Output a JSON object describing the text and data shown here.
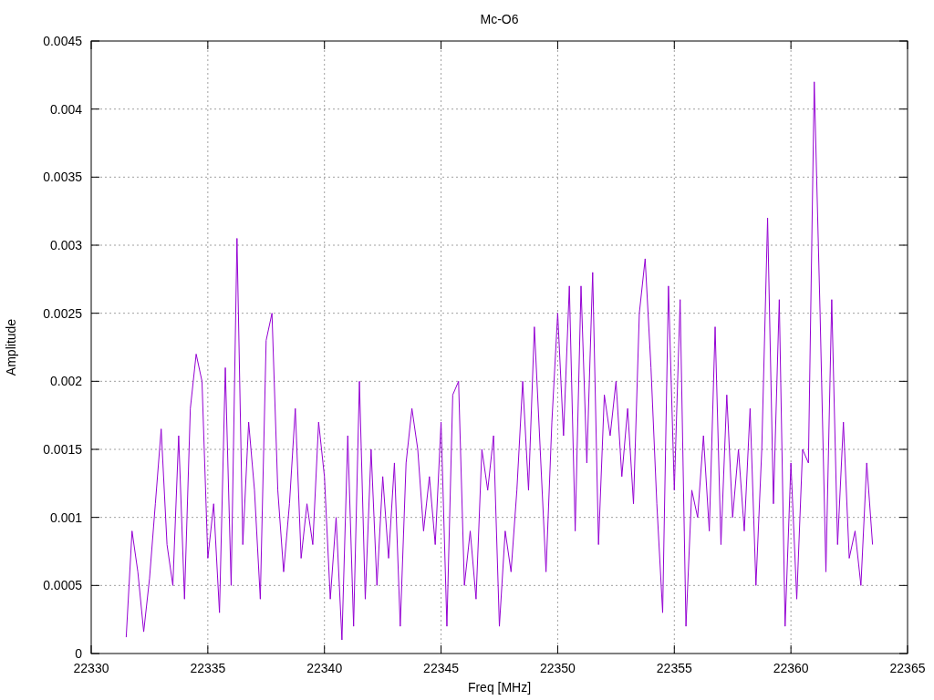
{
  "chart_data": {
    "type": "line",
    "grid": true,
    "title": "Mc-O6",
    "xlabel": "Freq [MHz]",
    "ylabel": "Amplitude",
    "x": [
      22331.5,
      22331.75,
      22332,
      22332.25,
      22332.5,
      22332.75,
      22333,
      22333.25,
      22333.5,
      22333.75,
      22334,
      22334.25,
      22334.5,
      22334.75,
      22335,
      22335.25,
      22335.5,
      22335.75,
      22336,
      22336.25,
      22336.5,
      22336.75,
      22337,
      22337.25,
      22337.5,
      22337.75,
      22338,
      22338.25,
      22338.5,
      22338.75,
      22339,
      22339.25,
      22339.5,
      22339.75,
      22340,
      22340.25,
      22340.5,
      22340.75,
      22341,
      22341.25,
      22341.5,
      22341.75,
      22342,
      22342.25,
      22342.5,
      22342.75,
      22343,
      22343.25,
      22343.5,
      22343.75,
      22344,
      22344.25,
      22344.5,
      22344.75,
      22345,
      22345.25,
      22345.5,
      22345.75,
      22346,
      22346.25,
      22346.5,
      22346.75,
      22347,
      22347.25,
      22347.5,
      22347.75,
      22348,
      22348.25,
      22348.5,
      22348.75,
      22349,
      22349.25,
      22349.5,
      22349.75,
      22350,
      22350.25,
      22350.5,
      22350.75,
      22351,
      22351.25,
      22351.5,
      22351.75,
      22352,
      22352.25,
      22352.5,
      22352.75,
      22353,
      22353.25,
      22353.5,
      22353.75,
      22354,
      22354.25,
      22354.5,
      22354.75,
      22355,
      22355.25,
      22355.5,
      22355.75,
      22356,
      22356.25,
      22356.5,
      22356.75,
      22357,
      22357.25,
      22357.5,
      22357.75,
      22358,
      22358.25,
      22358.5,
      22358.75,
      22359,
      22359.25,
      22359.5,
      22359.75,
      22360,
      22360.25,
      22360.5,
      22360.75,
      22361,
      22361.25,
      22361.5,
      22361.75,
      22362,
      22362.25,
      22362.5,
      22362.75,
      22363,
      22363.25,
      22363.5
    ],
    "series": [
      {
        "color": "#9400d3",
        "values": [
          0.00012,
          0.0009,
          0.0006,
          0.00016,
          0.00055,
          0.0011,
          0.00165,
          0.0008,
          0.0005,
          0.0016,
          0.0004,
          0.0018,
          0.0022,
          0.002,
          0.0007,
          0.0011,
          0.0003,
          0.0021,
          0.0005,
          0.00305,
          0.0008,
          0.0017,
          0.0012,
          0.0004,
          0.0023,
          0.0025,
          0.0012,
          0.0006,
          0.0011,
          0.0018,
          0.0007,
          0.0011,
          0.0008,
          0.0017,
          0.0013,
          0.0004,
          0.001,
          0.0001,
          0.0016,
          0.0002,
          0.002,
          0.0004,
          0.0015,
          0.0005,
          0.0013,
          0.0007,
          0.0014,
          0.0002,
          0.0014,
          0.0018,
          0.0015,
          0.0009,
          0.0013,
          0.0008,
          0.0017,
          0.0002,
          0.0019,
          0.002,
          0.0005,
          0.0009,
          0.0004,
          0.0015,
          0.0012,
          0.0016,
          0.0002,
          0.0009,
          0.0006,
          0.0012,
          0.002,
          0.0012,
          0.0024,
          0.0015,
          0.0006,
          0.0017,
          0.0025,
          0.0016,
          0.0027,
          0.0009,
          0.0027,
          0.0014,
          0.0028,
          0.0008,
          0.0019,
          0.0016,
          0.002,
          0.0013,
          0.0018,
          0.0011,
          0.0025,
          0.0029,
          0.0021,
          0.0011,
          0.0003,
          0.0027,
          0.0012,
          0.0026,
          0.0002,
          0.0012,
          0.001,
          0.0016,
          0.0009,
          0.0024,
          0.0008,
          0.0019,
          0.001,
          0.0015,
          0.0009,
          0.0018,
          0.0005,
          0.0015,
          0.0032,
          0.0011,
          0.0026,
          0.0002,
          0.0014,
          0.0004,
          0.0015,
          0.0014,
          0.0042,
          0.0025,
          0.0006,
          0.0026,
          0.0008,
          0.0017,
          0.0007,
          0.0009,
          0.0005,
          0.0014,
          0.0008
        ]
      }
    ],
    "xlim": [
      22330,
      22365
    ],
    "ylim": [
      0,
      0.0045
    ],
    "xticks": [
      22330,
      22335,
      22340,
      22345,
      22350,
      22355,
      22360,
      22365
    ],
    "yticks": [
      0,
      0.0005,
      0.001,
      0.0015,
      0.002,
      0.0025,
      0.003,
      0.0035,
      0.004,
      0.0045
    ]
  }
}
